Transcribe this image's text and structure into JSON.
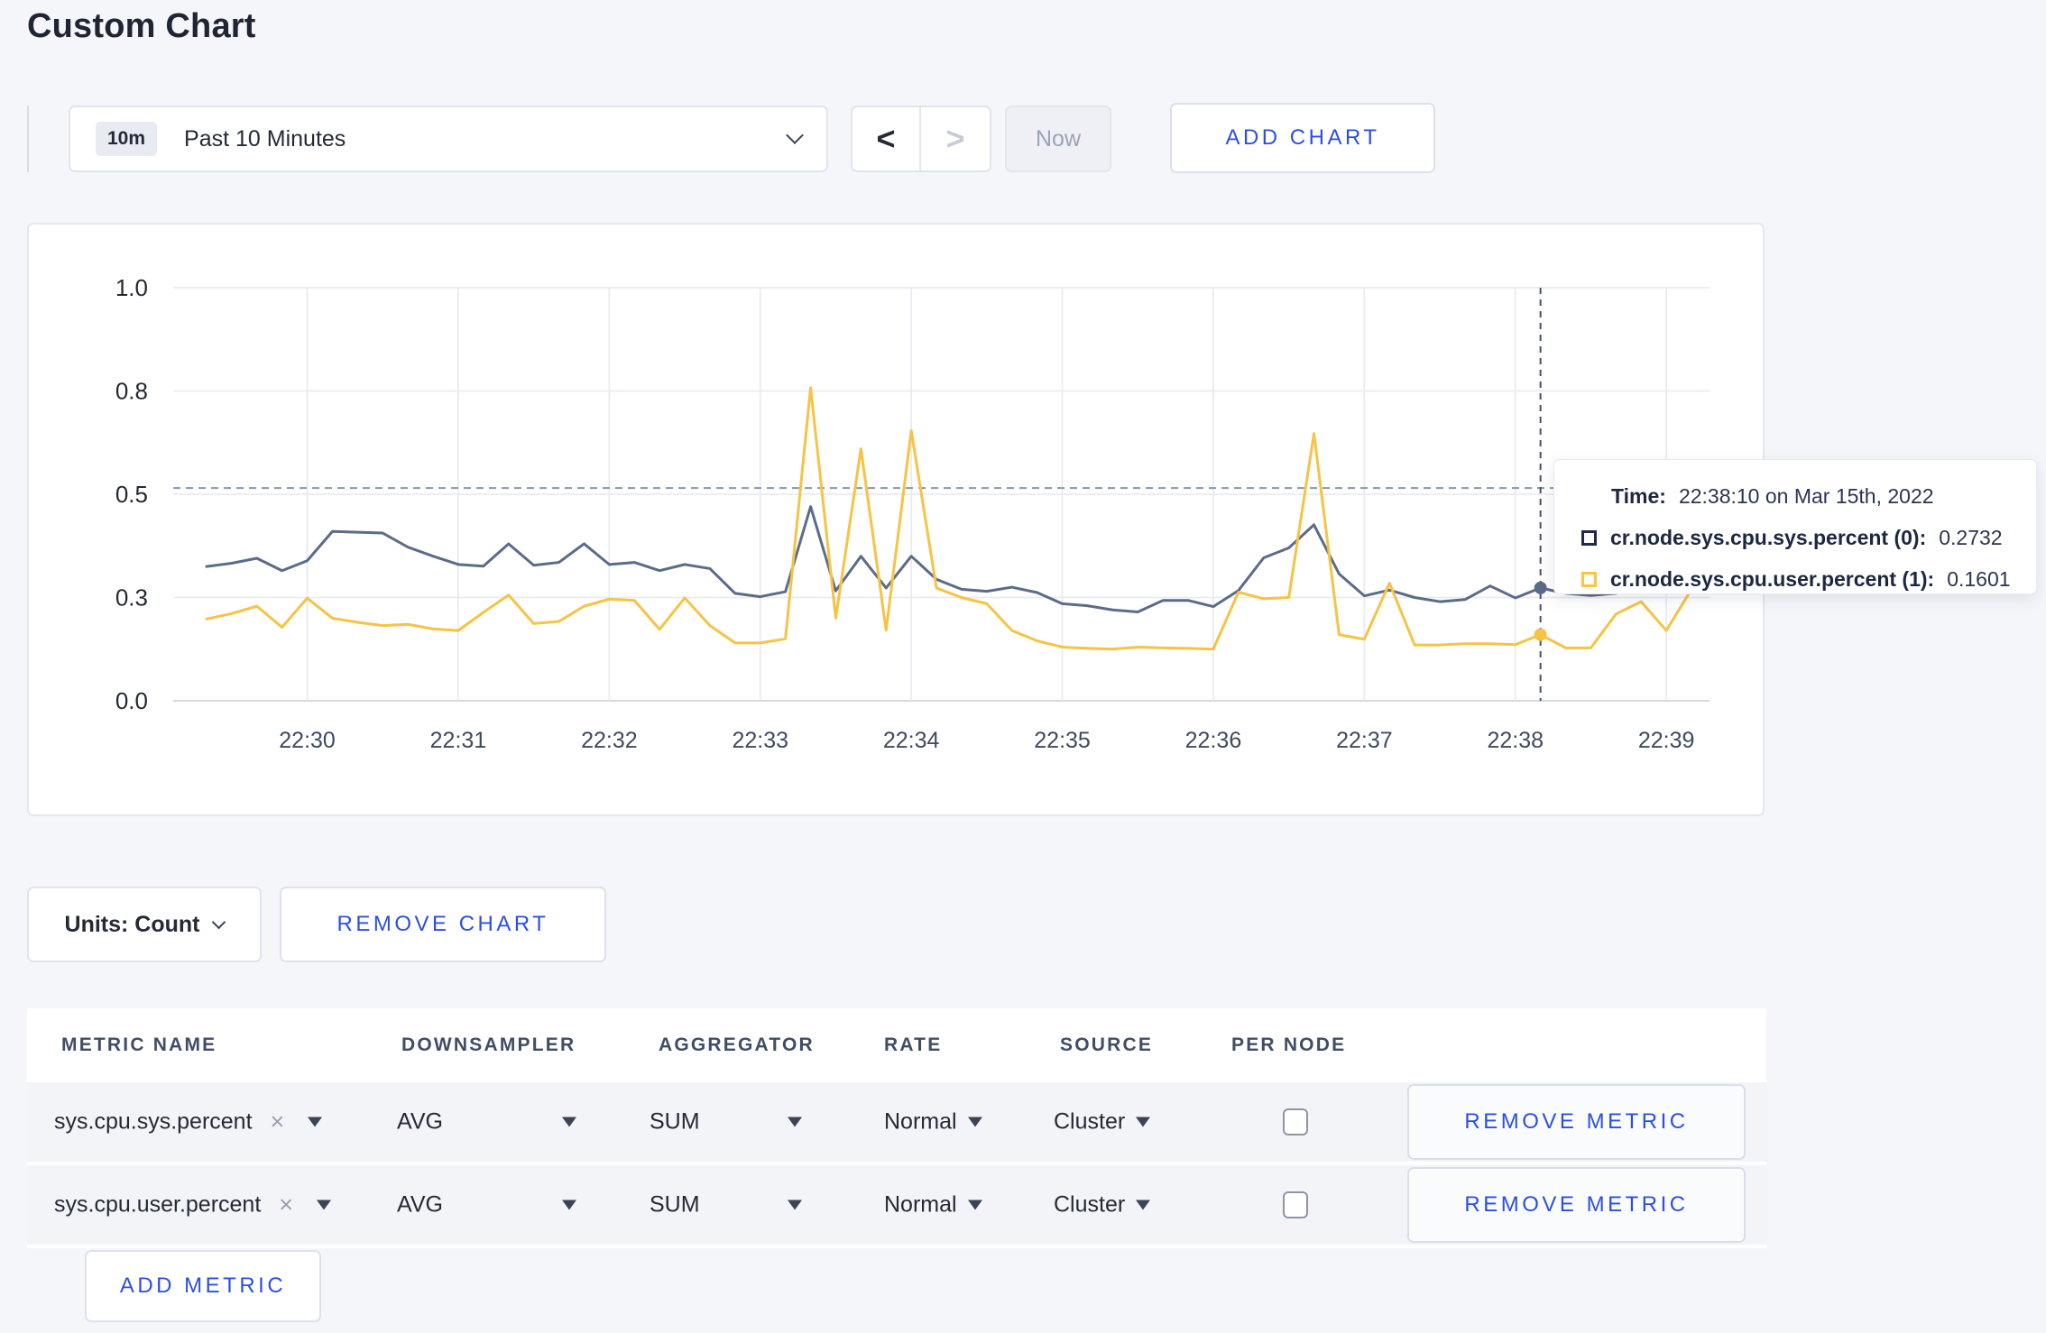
{
  "page": {
    "title": "Custom Chart"
  },
  "toolbar": {
    "range_badge": "10m",
    "range_label": "Past 10 Minutes",
    "prev_icon": "<",
    "next_icon": ">",
    "now_label": "Now",
    "add_chart_label": "ADD CHART"
  },
  "colors": {
    "accent_blue": "#2b4fe2",
    "series_sys": "#5b6b88",
    "series_user": "#f6c344",
    "tooltip_sys_square": "#1c2b4d",
    "tooltip_user_square": "#ffc43d",
    "grid": "#eaebf0",
    "axis": "#d6d8de",
    "guideline": "#8498ae",
    "crosshair": "#44506b"
  },
  "chart_data": {
    "type": "line",
    "title": "",
    "xlabel": "",
    "ylabel": "",
    "grid": true,
    "legend_position": "tooltip",
    "ylim": [
      0,
      1
    ],
    "y_axis": {
      "tick_labels": [
        "0.0",
        "0.3",
        "0.5",
        "0.8",
        "1.0"
      ],
      "tick_values": [
        0,
        0.25,
        0.5,
        0.75,
        1
      ]
    },
    "x_axis": {
      "tick_labels": [
        "22:30",
        "22:31",
        "22:32",
        "22:33",
        "22:34",
        "22:35",
        "22:36",
        "22:37",
        "22:38",
        "22:39"
      ],
      "window_start": "22:29:15",
      "window_seconds": 600,
      "first_tick_offset_s": 45,
      "tick_interval_s": 60
    },
    "first_sample_offset_s": 5,
    "sample_interval_s": 10,
    "guideline_value": 0.515,
    "series": [
      {
        "name": "cr.node.sys.cpu.sys.percent",
        "values": [
          0.325,
          0.333,
          0.345,
          0.315,
          0.339,
          0.41,
          0.408,
          0.406,
          0.372,
          0.35,
          0.33,
          0.326,
          0.38,
          0.328,
          0.335,
          0.38,
          0.33,
          0.335,
          0.315,
          0.33,
          0.32,
          0.26,
          0.252,
          0.264,
          0.47,
          0.266,
          0.35,
          0.273,
          0.35,
          0.294,
          0.27,
          0.265,
          0.275,
          0.262,
          0.235,
          0.23,
          0.22,
          0.215,
          0.243,
          0.243,
          0.228,
          0.267,
          0.346,
          0.37,
          0.426,
          0.307,
          0.254,
          0.268,
          0.25,
          0.24,
          0.245,
          0.278,
          0.249,
          0.2732,
          0.26,
          0.255,
          0.26,
          0.27,
          0.265,
          0.275
        ]
      },
      {
        "name": "cr.node.sys.cpu.user.percent",
        "values": [
          0.198,
          0.211,
          0.229,
          0.178,
          0.2485,
          0.2,
          0.19,
          0.182,
          0.185,
          0.174,
          0.17,
          0.214,
          0.256,
          0.187,
          0.192,
          0.229,
          0.246,
          0.243,
          0.173,
          0.249,
          0.182,
          0.14,
          0.14,
          0.15,
          0.758,
          0.2,
          0.61,
          0.171,
          0.654,
          0.273,
          0.25,
          0.235,
          0.17,
          0.145,
          0.13,
          0.127,
          0.125,
          0.13,
          0.128,
          0.127,
          0.125,
          0.263,
          0.247,
          0.25,
          0.647,
          0.16,
          0.149,
          0.285,
          0.135,
          0.135,
          0.138,
          0.138,
          0.136,
          0.1601,
          0.128,
          0.128,
          0.21,
          0.24,
          0.17,
          0.27
        ]
      }
    ],
    "crosshair": {
      "time": "22:38:10",
      "time_offset_s": 535,
      "points": [
        {
          "series": 0,
          "value": 0.2732
        },
        {
          "series": 1,
          "value": 0.1601
        }
      ]
    }
  },
  "tooltip": {
    "time_label": "Time:",
    "time_value": "22:38:10 on Mar 15th, 2022",
    "rows": [
      {
        "label": "cr.node.sys.cpu.sys.percent (0):",
        "value": "0.2732"
      },
      {
        "label": "cr.node.sys.cpu.user.percent (1):",
        "value": "0.1601"
      }
    ]
  },
  "chart_footer": {
    "units_label": "Units: Count",
    "remove_chart_label": "REMOVE CHART"
  },
  "metrics_table": {
    "headers": [
      "METRIC NAME",
      "DOWNSAMPLER",
      "AGGREGATOR",
      "RATE",
      "SOURCE",
      "PER NODE"
    ],
    "close_icon": "×",
    "rows": [
      {
        "metric": "sys.cpu.sys.percent",
        "downsampler": "AVG",
        "aggregator": "SUM",
        "rate": "Normal",
        "source": "Cluster",
        "per_node_checked": false,
        "remove_label": "REMOVE METRIC"
      },
      {
        "metric": "sys.cpu.user.percent",
        "downsampler": "AVG",
        "aggregator": "SUM",
        "rate": "Normal",
        "source": "Cluster",
        "per_node_checked": false,
        "remove_label": "REMOVE METRIC"
      }
    ],
    "add_metric_label": "ADD METRIC"
  }
}
